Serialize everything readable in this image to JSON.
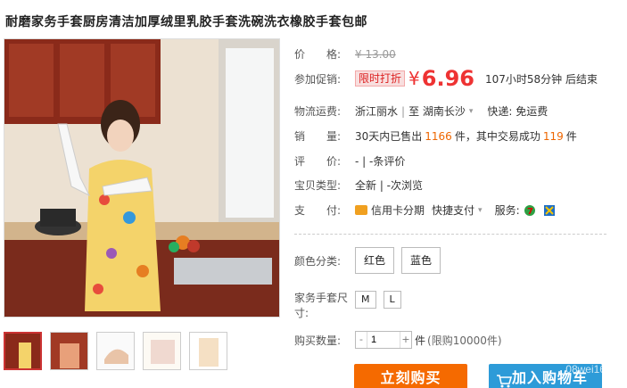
{
  "title": "耐磨家务手套厨房清洁加厚绒里乳胶手套洗碗洗衣橡胶手套包邮",
  "price": {
    "label": "价　　格:",
    "original": "¥ 13.00"
  },
  "promo": {
    "label": "参加促销:",
    "tag": "限时打折",
    "yen": "¥",
    "price": "6.96",
    "countdown": "107小时58分钟 后结束"
  },
  "shipping": {
    "label": "物流运费:",
    "from": "浙江丽水",
    "to": "至  湖南长沙",
    "express": "快递: 免运费"
  },
  "sales": {
    "label": "销　　量:",
    "prefix": "30天内已售出",
    "count": "1166",
    "mid": "件，其中交易成功",
    "success": "119",
    "suffix": "件"
  },
  "rating": {
    "label": "评　　价:",
    "value": "-  |  -条评价"
  },
  "item_type": {
    "label": "宝贝类型:",
    "value": "全新  |  -次浏览"
  },
  "payment": {
    "label": "支　　付:",
    "credit": "信用卡分期",
    "quick": "快捷支付",
    "service_label": "服务:"
  },
  "color": {
    "label": "颜色分类:",
    "options": [
      "红色",
      "蓝色"
    ]
  },
  "size": {
    "label": "家务手套尺寸:",
    "options": [
      "M",
      "L"
    ]
  },
  "quantity": {
    "label": "购买数量:",
    "minus": "-",
    "plus": "+",
    "value": "1",
    "unit": "件",
    "limit": "(限购10000件)"
  },
  "buttons": {
    "buy": "立刻购买",
    "cart": "加入购物车"
  },
  "watermark": "08wei16.co",
  "colors": {
    "accent": "#e33",
    "buy": "#f56a00",
    "cart": "#2d9bd8"
  },
  "icons": [
    "credit-card-icon",
    "chevron-down-icon",
    "seven-day-return-icon",
    "guarantee-icon",
    "cart-icon"
  ]
}
